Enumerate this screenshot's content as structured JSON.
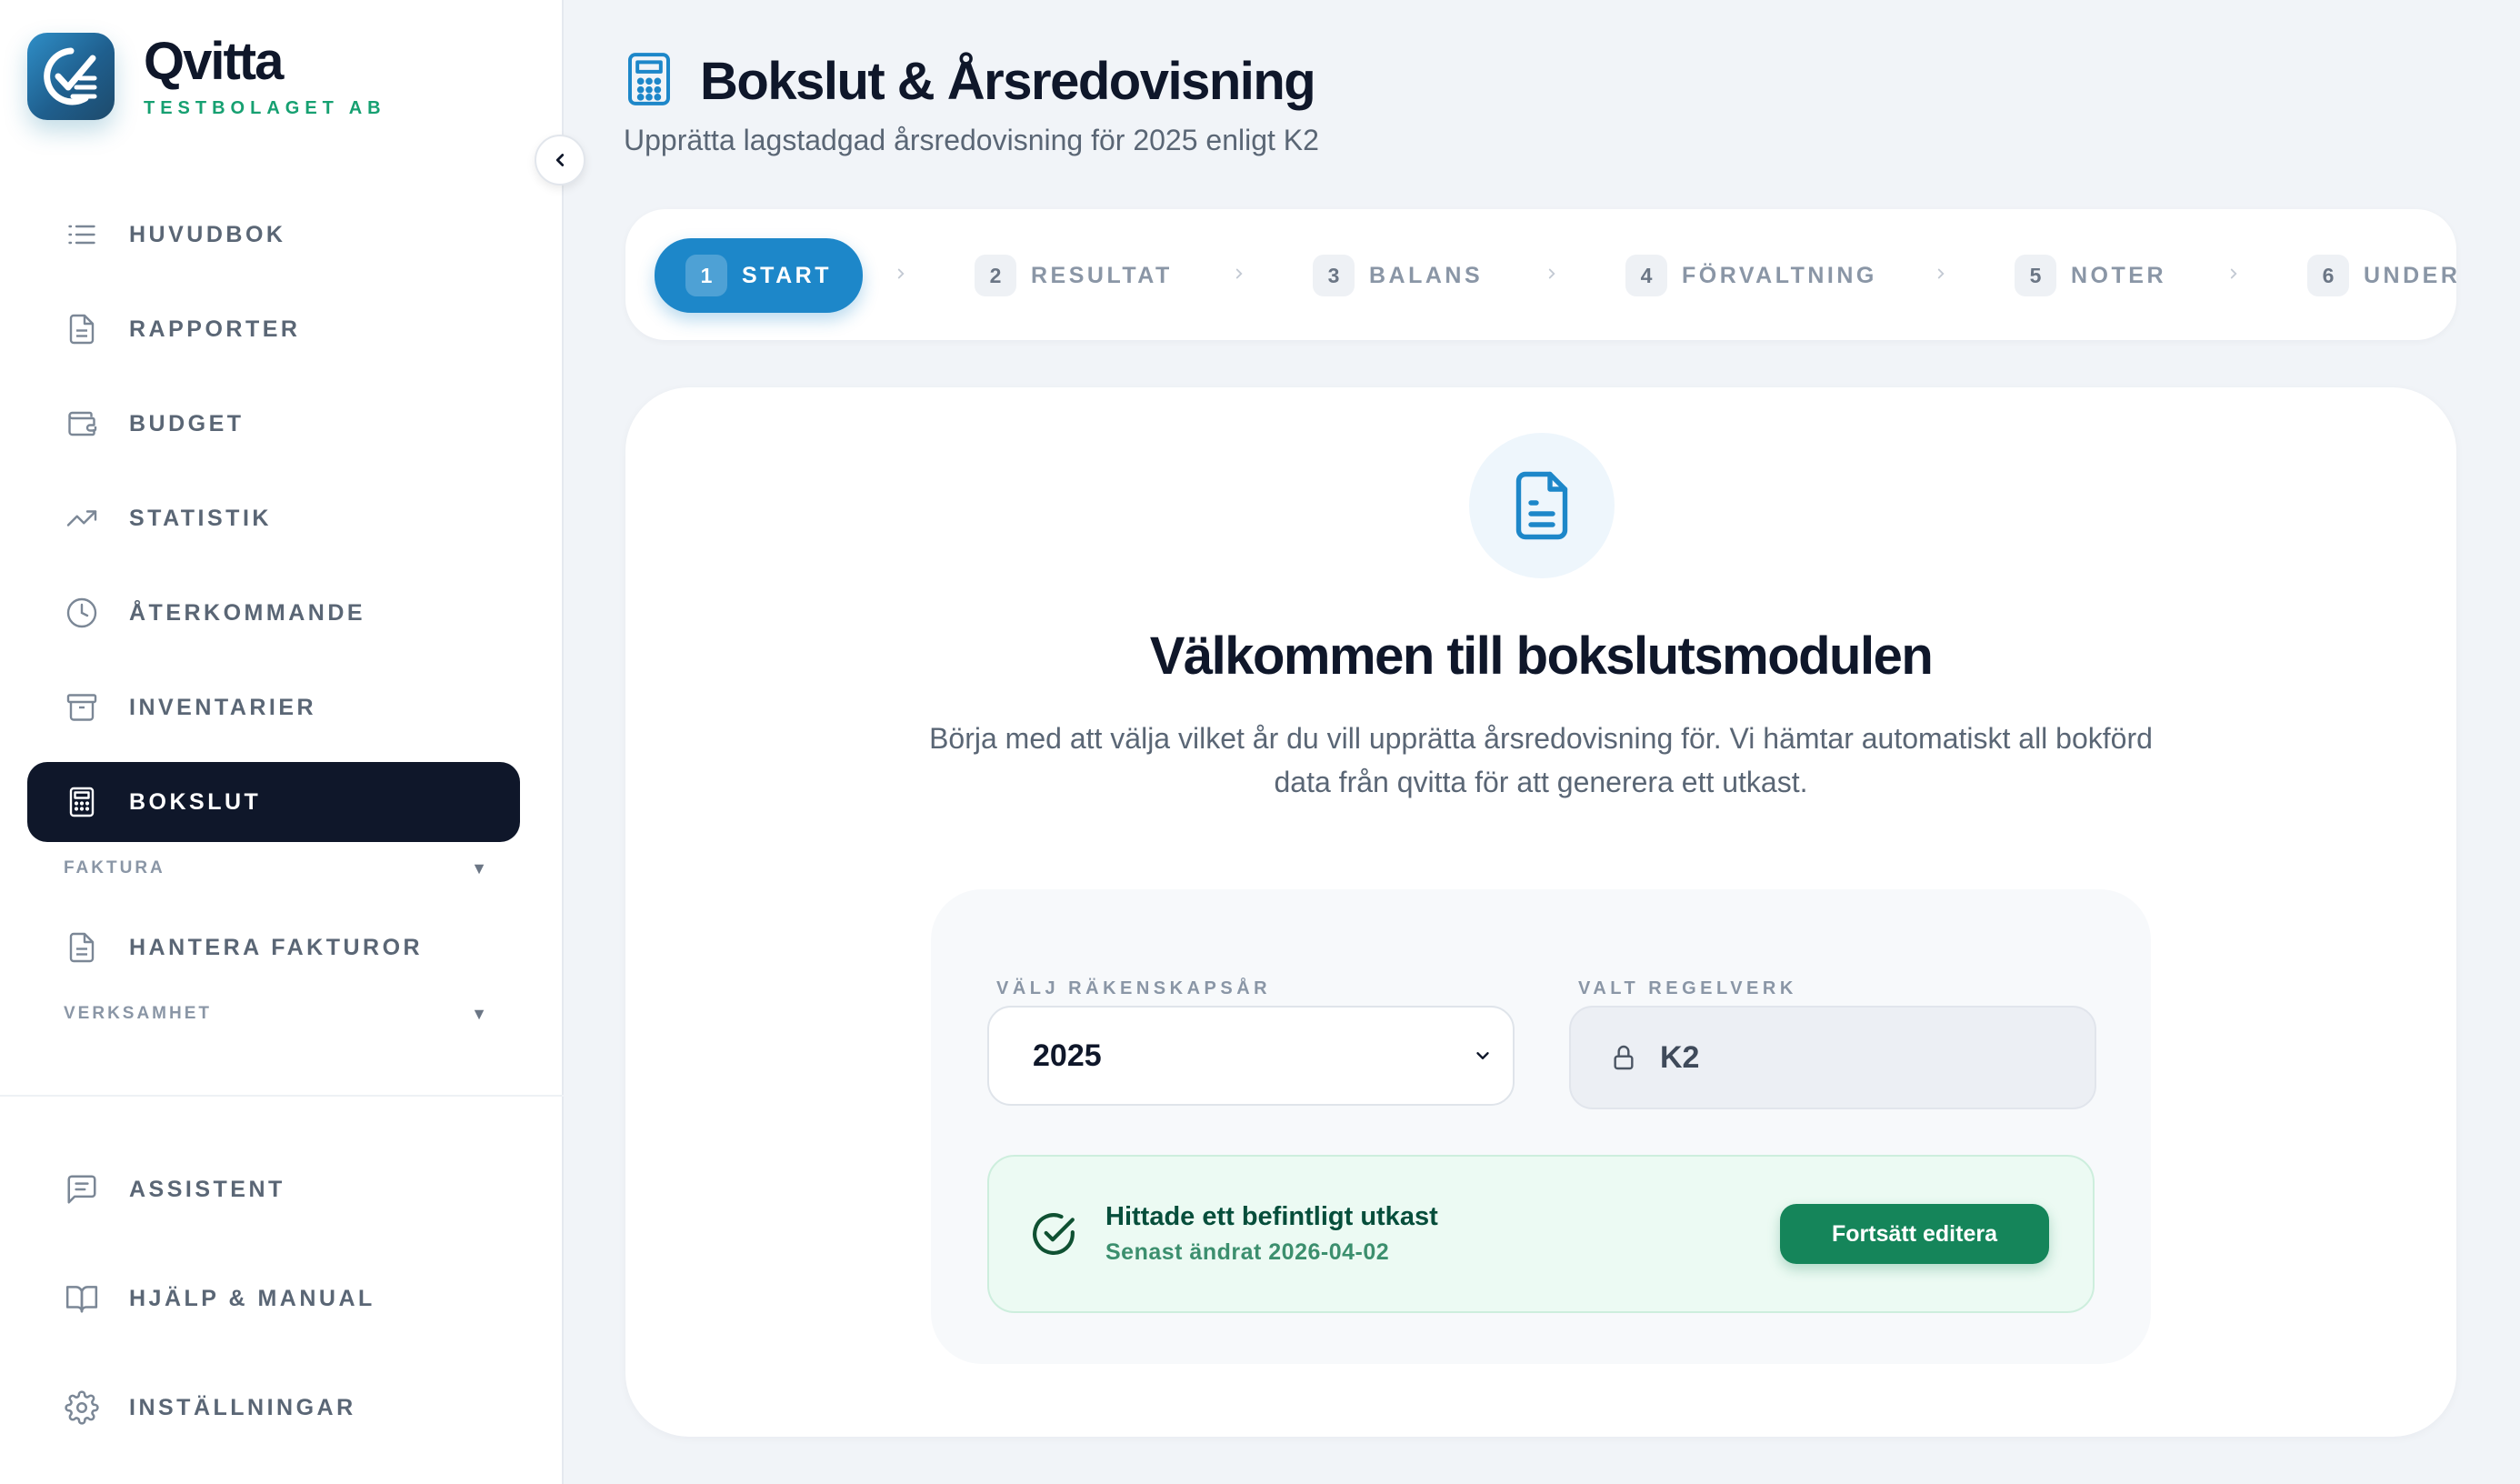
{
  "brand": {
    "name": "Qvitta",
    "company": "TESTBOLAGET AB"
  },
  "sidebar": {
    "items": [
      {
        "label": "HUVUDBOK",
        "icon": "list-icon"
      },
      {
        "label": "RAPPORTER",
        "icon": "document-icon"
      },
      {
        "label": "BUDGET",
        "icon": "wallet-icon"
      },
      {
        "label": "STATISTIK",
        "icon": "trend-icon"
      },
      {
        "label": "ÅTERKOMMANDE",
        "icon": "clock-icon"
      },
      {
        "label": "INVENTARIER",
        "icon": "archive-icon"
      },
      {
        "label": "BOKSLUT",
        "icon": "calculator-icon",
        "active": true
      }
    ],
    "sections": [
      {
        "label": "FAKTURA",
        "items": [
          {
            "label": "HANTERA FAKTUROR",
            "icon": "document-icon"
          }
        ]
      },
      {
        "label": "VERKSAMHET"
      }
    ],
    "bottom": [
      {
        "label": "ASSISTENT",
        "icon": "chat-icon"
      },
      {
        "label": "HJÄLP & MANUAL",
        "icon": "book-icon"
      },
      {
        "label": "INSTÄLLNINGAR",
        "icon": "gear-icon"
      }
    ]
  },
  "header": {
    "title": "Bokslut & Årsredovisning",
    "subtitle": "Upprätta lagstadgad årsredovisning för 2025 enligt K2"
  },
  "steps": [
    {
      "num": "1",
      "label": "START",
      "active": true
    },
    {
      "num": "2",
      "label": "RESULTAT"
    },
    {
      "num": "3",
      "label": "BALANS"
    },
    {
      "num": "4",
      "label": "FÖRVALTNING"
    },
    {
      "num": "5",
      "label": "NOTER"
    },
    {
      "num": "6",
      "label": "UNDERSKRIFTER"
    }
  ],
  "welcome": {
    "title": "Välkommen till bokslutsmodulen",
    "description": "Börja med att välja vilket år du vill upprätta årsredovisning för. Vi hämtar automatiskt all bokförd data från qvitta för att generera ett utkast."
  },
  "form": {
    "year_label": "VÄLJ RÄKENSKAPSÅR",
    "year_value": "2025",
    "framework_label": "VALT REGELVERK",
    "framework_value": "K2"
  },
  "draft": {
    "title": "Hittade ett befintligt utkast",
    "subtitle": "Senast ändrat 2026-04-02",
    "button": "Fortsätt editera"
  },
  "colors": {
    "accent": "#1d87c9",
    "dark": "#0f172a",
    "success": "#15855a",
    "brand_green": "#16a071"
  }
}
